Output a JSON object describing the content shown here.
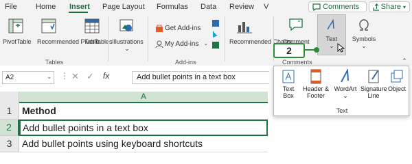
{
  "tabs": [
    "File",
    "Home",
    "Insert",
    "Page Layout",
    "Formulas",
    "Data",
    "Review",
    "V"
  ],
  "comments_label": "Comments",
  "share_label": "Share",
  "ribbon": {
    "pivottable": "PivotTable",
    "recommended_pivottables": "Recommended PivotTables",
    "table": "Table",
    "illustrations": "Illustrations",
    "get_addins": "Get Add-ins",
    "my_addins": "My Add-ins",
    "recommended_charts": "Recommended Charts",
    "comment": "Comment",
    "text": "Text",
    "symbols": "Symbols",
    "group_tables": "Tables",
    "group_addins": "Add-ins",
    "group_comments": "Comments"
  },
  "formula_bar": {
    "name_box": "A2",
    "fx": "fx",
    "content": "Add bullet points in a text box"
  },
  "sheet": {
    "column": "A",
    "rows": [
      {
        "num": "1",
        "value": "Method"
      },
      {
        "num": "2",
        "value": "Add bullet points in a text box"
      },
      {
        "num": "3",
        "value": "Add bullet points using keyboard shortcuts"
      }
    ]
  },
  "dropdown": {
    "items": [
      "Text Box",
      "Header & Footer",
      "WordArt",
      "Signature Line",
      "Object"
    ],
    "group_label": "Text"
  },
  "callout": "2",
  "colors": {
    "accent": "#217346",
    "callout": "#2e8b3a",
    "icon_blue": "#2b6cb0"
  }
}
